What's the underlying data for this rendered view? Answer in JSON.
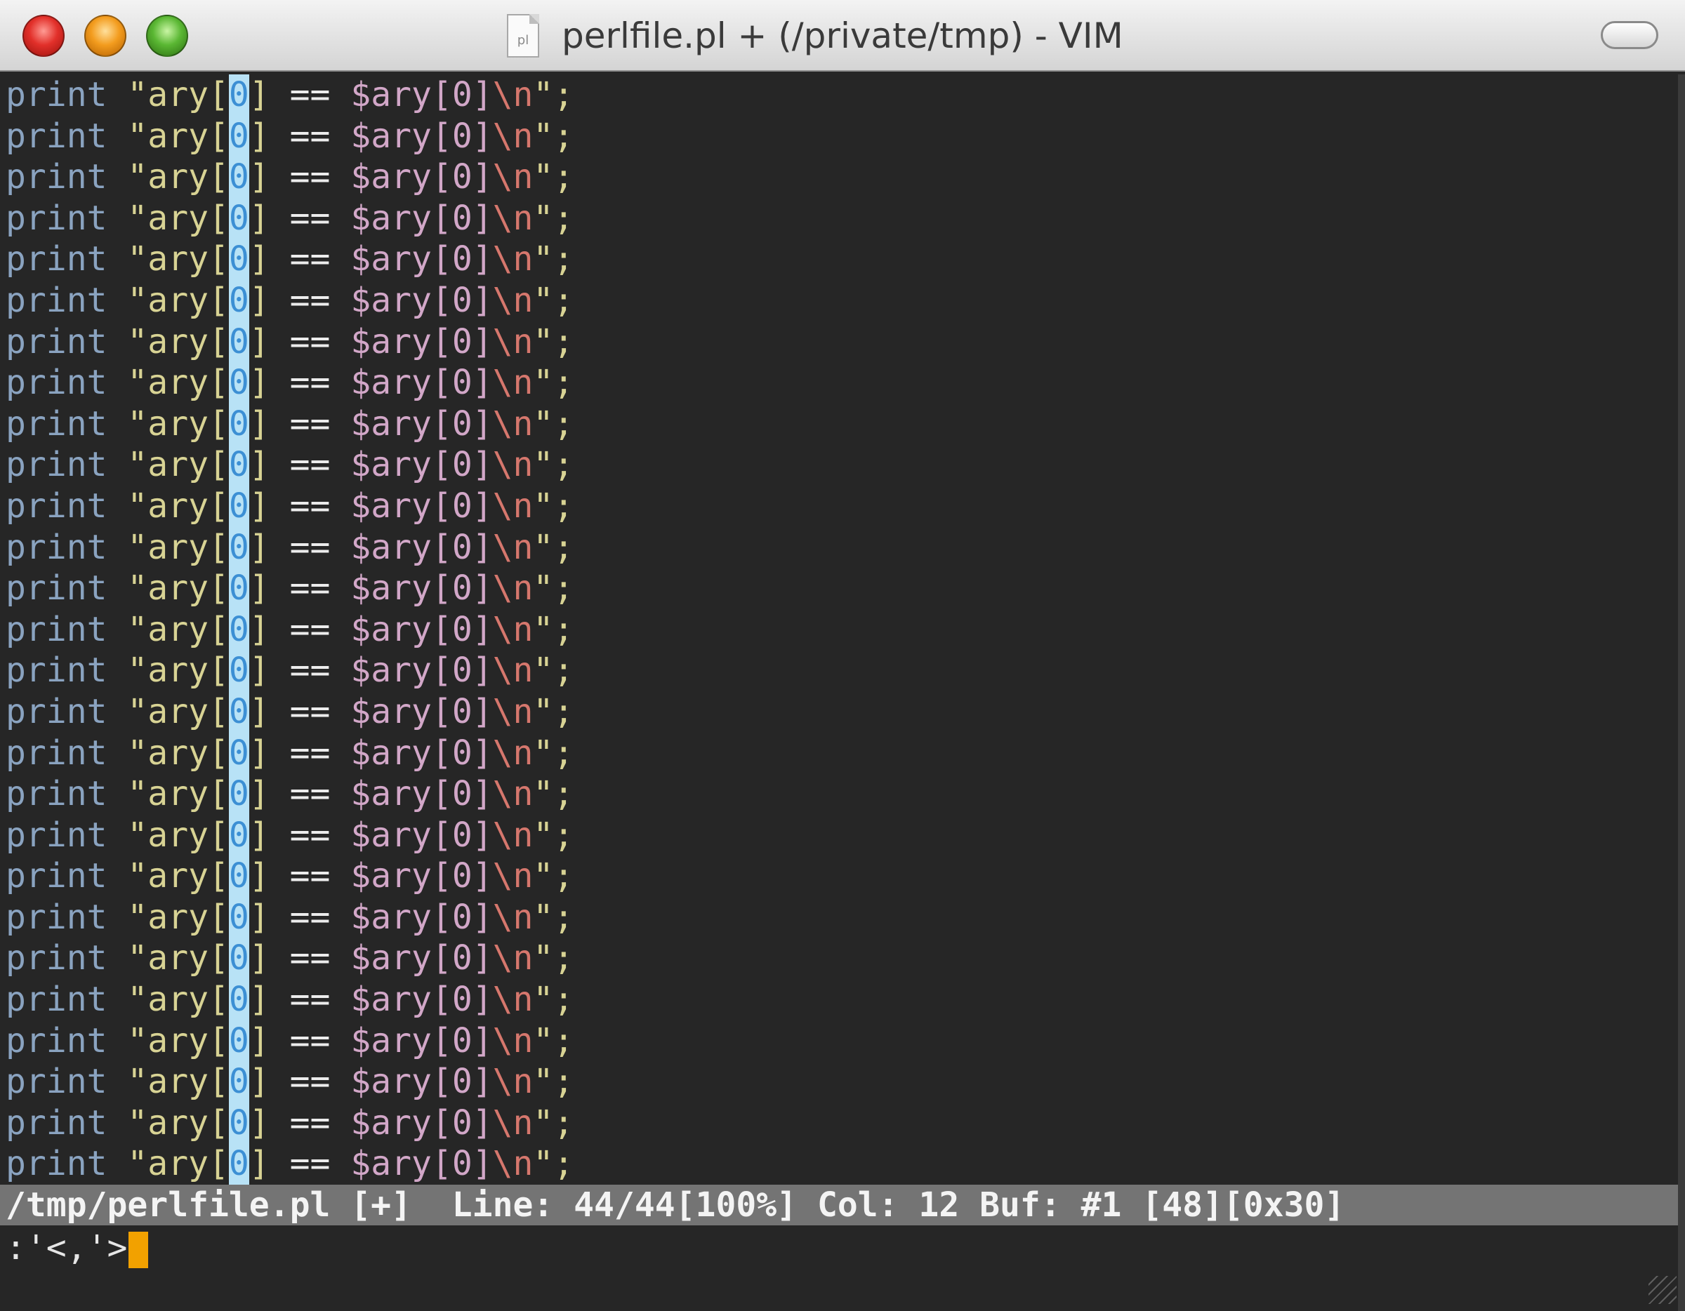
{
  "window": {
    "title": "perlfile.pl + (/private/tmp) - VIM",
    "doc_icon_text": "pl"
  },
  "editor": {
    "line": {
      "keyword": "print",
      "string_open": "\"ary[",
      "index": "0",
      "string_mid": "]",
      "operator": "==",
      "variable": "$ary[0]",
      "escape": "\\n",
      "terminator": "\";"
    },
    "visible_line_count": 27
  },
  "statusline": {
    "text": "/tmp/perlfile.pl [+]  Line: 44/44[100%] Col: 12 Buf: #1 [48][0x30]"
  },
  "cmdline": {
    "text": ":'<,'>"
  },
  "colors": {
    "keyword": "#8aa3c0",
    "string": "#d8d394",
    "selection": "#b8e2f6",
    "variable": "#d2a7c8",
    "escape": "#d6776d",
    "cursor": "#f2a100"
  }
}
